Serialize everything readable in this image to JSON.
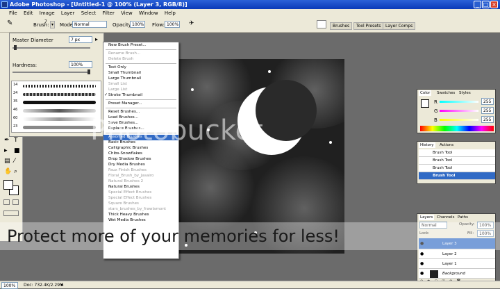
{
  "window": {
    "title": "Adobe Photoshop - [Untitled-1 @ 100% (Layer 3, RGB/8)]",
    "minimize": "_",
    "maximize": "□",
    "close": "×"
  },
  "menubar": [
    "File",
    "Edit",
    "Image",
    "Layer",
    "Select",
    "Filter",
    "View",
    "Window",
    "Help"
  ],
  "options": {
    "brush_label": "Brush:",
    "brush_size": "7",
    "mode_label": "Mode:",
    "mode_value": "Normal",
    "opacity_label": "Opacity:",
    "opacity_value": "100%",
    "flow_label": "Flow:",
    "flow_value": "100%",
    "well_tabs": [
      "Brushes",
      "Tool Presets",
      "Layer Comps"
    ]
  },
  "brush_panel": {
    "master_diameter_label": "Master Diameter",
    "master_diameter_value": "7 px",
    "hardness_label": "Hardness:",
    "hardness_value": "100%",
    "brush_sizes": [
      "14",
      "24",
      "35",
      "46",
      "60",
      "23"
    ]
  },
  "brush_menu": {
    "items": [
      {
        "label": "New Brush Preset...",
        "state": "enabled"
      },
      {
        "label": "Rename Brush...",
        "state": "disabled"
      },
      {
        "label": "Delete Brush",
        "state": "disabled"
      },
      {
        "label": "Text Only",
        "state": "enabled"
      },
      {
        "label": "Small Thumbnail",
        "state": "enabled"
      },
      {
        "label": "Large Thumbnail",
        "state": "enabled"
      },
      {
        "label": "Small List",
        "state": "disabled"
      },
      {
        "label": "Large List",
        "state": "disabled"
      },
      {
        "label": "Stroke Thumbnail",
        "state": "checked"
      },
      {
        "label": "Preset Manager...",
        "state": "enabled"
      },
      {
        "label": "Reset Brushes...",
        "state": "enabled"
      },
      {
        "label": "Load Brushes...",
        "state": "enabled"
      },
      {
        "label": "Save Brushes...",
        "state": "enabled"
      },
      {
        "label": "Replace Brushes...",
        "state": "enabled"
      },
      {
        "label": "Assorted Brushes",
        "state": "selected"
      },
      {
        "label": "Basic Brushes",
        "state": "enabled"
      },
      {
        "label": "Calligraphic Brushes",
        "state": "enabled"
      },
      {
        "label": "Chibs-Snowflakes",
        "state": "enabled"
      },
      {
        "label": "Drop Shadow Brushes",
        "state": "enabled"
      },
      {
        "label": "Dry Media Brushes",
        "state": "enabled"
      },
      {
        "label": "Faux Finish Brushes",
        "state": "disabled"
      },
      {
        "label": "Floral_Brush_by_Jasairo",
        "state": "disabled"
      },
      {
        "label": "Natural Brushes 2",
        "state": "disabled"
      },
      {
        "label": "Natural Brushes",
        "state": "enabled"
      },
      {
        "label": "Special Effect Brushes",
        "state": "disabled"
      },
      {
        "label": "Special Effect Brushes",
        "state": "disabled"
      },
      {
        "label": "Square Brushes",
        "state": "disabled"
      },
      {
        "label": "stars_brushes_by_frawlamont",
        "state": "disabled"
      },
      {
        "label": "Thick Heavy Brushes",
        "state": "enabled"
      },
      {
        "label": "Wet Media Brushes",
        "state": "enabled"
      }
    ]
  },
  "watermark": {
    "top": "Photobucket",
    "bottom": "Protect more of your memories for less!"
  },
  "color_panel": {
    "tabs": [
      "Color",
      "Swatches",
      "Styles"
    ],
    "channels": [
      {
        "label": "R",
        "value": "255"
      },
      {
        "label": "G",
        "value": "255"
      },
      {
        "label": "B",
        "value": "255"
      }
    ]
  },
  "history_panel": {
    "tabs": [
      "History",
      "Actions"
    ],
    "items": [
      "Brush Tool",
      "Brush Tool",
      "Brush Tool",
      "Brush Tool"
    ]
  },
  "layers_panel": {
    "tabs": [
      "Layers",
      "Channels",
      "Paths"
    ],
    "blend_mode": "Normal",
    "opacity_label": "Opacity:",
    "opacity_value": "100%",
    "lock_label": "Lock:",
    "fill_label": "Fill:",
    "fill_value": "100%",
    "layers": [
      "Layer 3",
      "Layer 2",
      "Layer 1",
      "Background"
    ]
  },
  "status": {
    "zoom": "100%",
    "doc": "Doc: 732.4K/2.29M"
  },
  "colors": {
    "title_blue": "#0a3ab8",
    "selection": "#316ac5",
    "panel_bg": "#ece9d8"
  }
}
